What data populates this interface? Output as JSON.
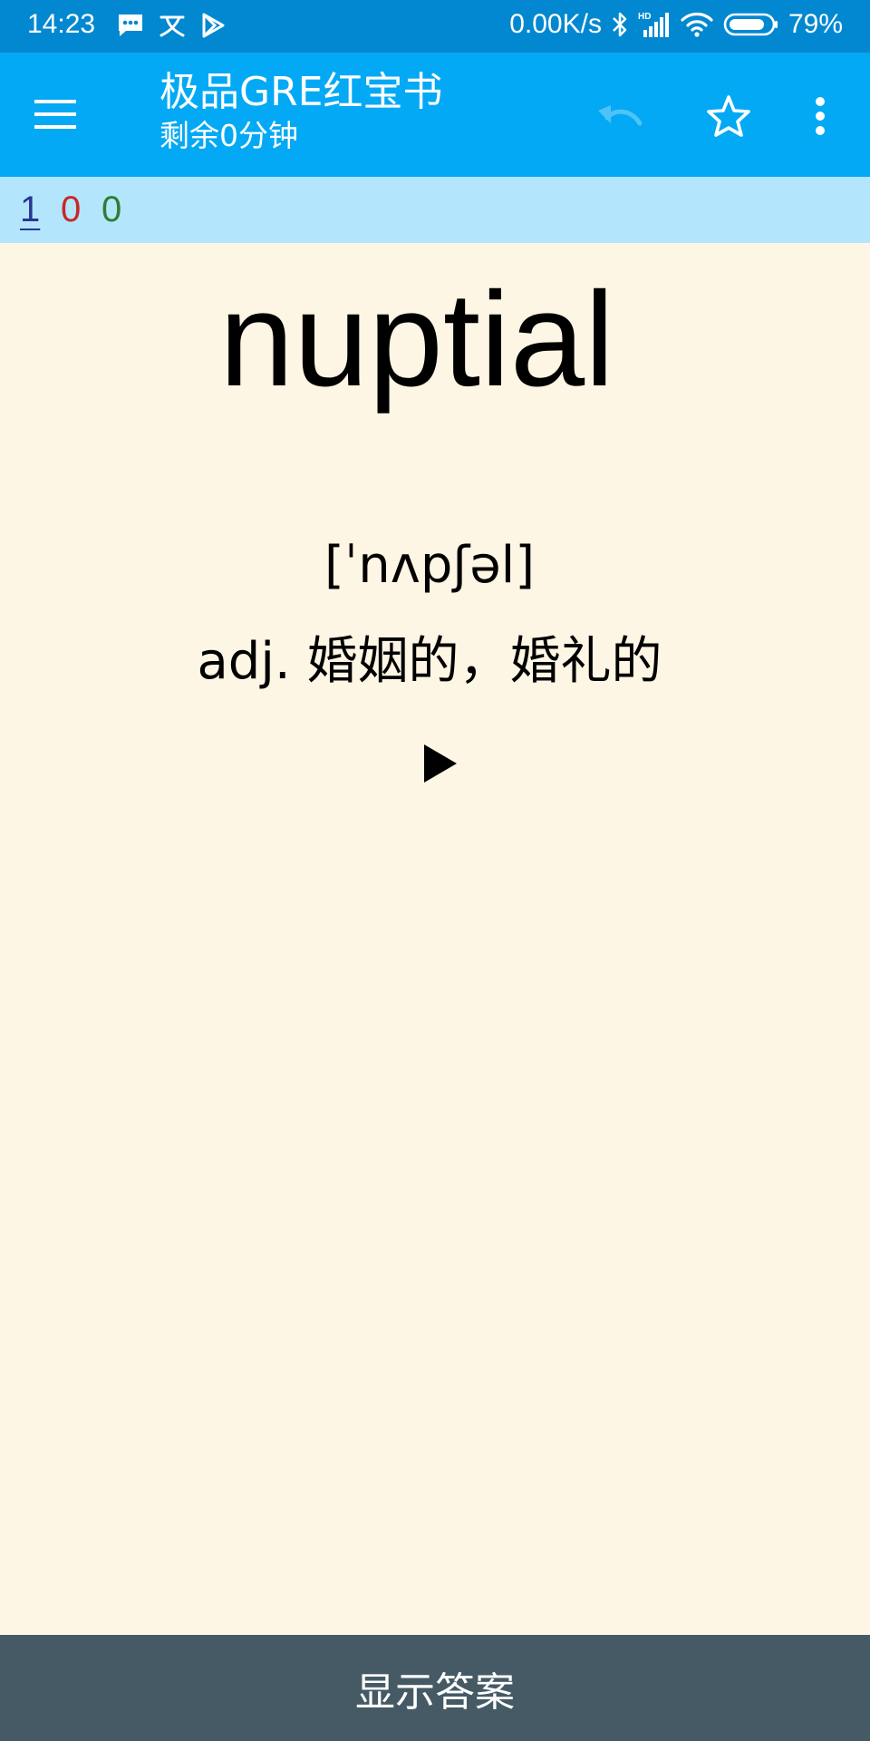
{
  "status_bar": {
    "time": "14:23",
    "left_icons": [
      "message-icon",
      "translate-icon",
      "play-store-icon"
    ],
    "network_speed": "0.00K/s",
    "right_icons": [
      "bluetooth-icon",
      "hd-signal-icon",
      "wifi-icon",
      "battery-icon"
    ],
    "battery_percent": "79%"
  },
  "app_bar": {
    "title": "极品GRE红宝书",
    "subtitle": "剩余0分钟",
    "menu_icon": "menu-icon",
    "undo_icon": "undo-icon",
    "star_icon": "star-outline-icon",
    "more_icon": "more-vert-icon"
  },
  "counts": {
    "new": "1",
    "learning": "0",
    "review": "0"
  },
  "card": {
    "word": "nuptial",
    "phonetic": "[ˈnʌpʃəl]",
    "definition": "adj. 婚姻的，婚礼的",
    "play_icon": "play-icon"
  },
  "bottom": {
    "show_answer_label": "显示答案"
  },
  "colors": {
    "status_bar": "#0288d1",
    "app_bar": "#03a9f4",
    "counter_bar": "#b3e5fc",
    "card_background": "#fef6e4",
    "bottom_button": "#455a64",
    "count_new": "#283593",
    "count_learning": "#c62828",
    "count_review": "#2e7d32"
  }
}
